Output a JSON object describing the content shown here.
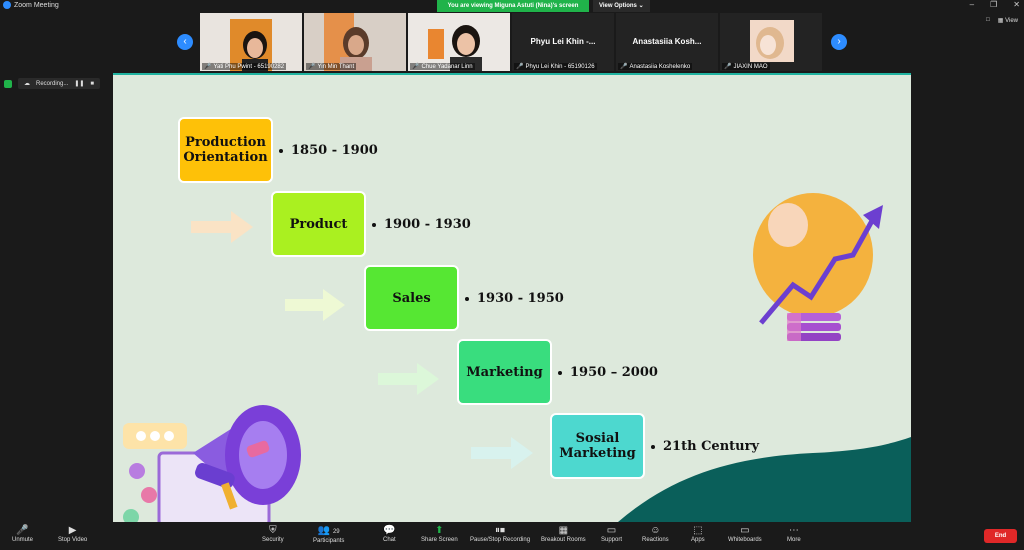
{
  "window": {
    "title": "Zoom Meeting"
  },
  "banner": {
    "viewing": "You are viewing Miguna Astuti (Nina)'s screen",
    "view_options": "View Options"
  },
  "view_button": {
    "label": "View"
  },
  "participants": [
    {
      "name": "Yati Phu Pwint - 65190282",
      "video": true
    },
    {
      "name": "Yin Min Thant",
      "video": true
    },
    {
      "name": "Chue Yadanar Linn",
      "video": true
    },
    {
      "name": "Phyu Lei Khin - 65190126",
      "display": "Phyu Lei Khin -...",
      "video": false
    },
    {
      "name": "Anastasiia Koshelenko",
      "display": "Anastasiia Kosh...",
      "video": false
    },
    {
      "name": "JIAXIN MAO",
      "video": true
    }
  ],
  "recording": {
    "label": "Recording..."
  },
  "slide": {
    "steps": [
      {
        "label": "Production Orientation",
        "period": "1850 - 1900",
        "color": "#fec108"
      },
      {
        "label": "Product",
        "period": "1900 - 1930",
        "color": "#aaf020"
      },
      {
        "label": "Sales",
        "period": "1930 - 1950",
        "color": "#56e733"
      },
      {
        "label": "Marketing",
        "period": "1950 – 2000",
        "color": "#39dd7e"
      },
      {
        "label": "Sosial Marketing",
        "period": "21th Century",
        "color": "#4dd8cf"
      }
    ]
  },
  "toolbar": {
    "unmute": "Unmute",
    "stop_video": "Stop Video",
    "security": "Security",
    "participants": "Participants",
    "participants_count": "29",
    "chat": "Chat",
    "share_screen": "Share Screen",
    "pause_recording": "Pause/Stop Recording",
    "breakout_rooms": "Breakout Rooms",
    "support": "Support",
    "reactions": "Reactions",
    "apps": "Apps",
    "whiteboards": "Whiteboards",
    "more": "More",
    "end": "End"
  }
}
